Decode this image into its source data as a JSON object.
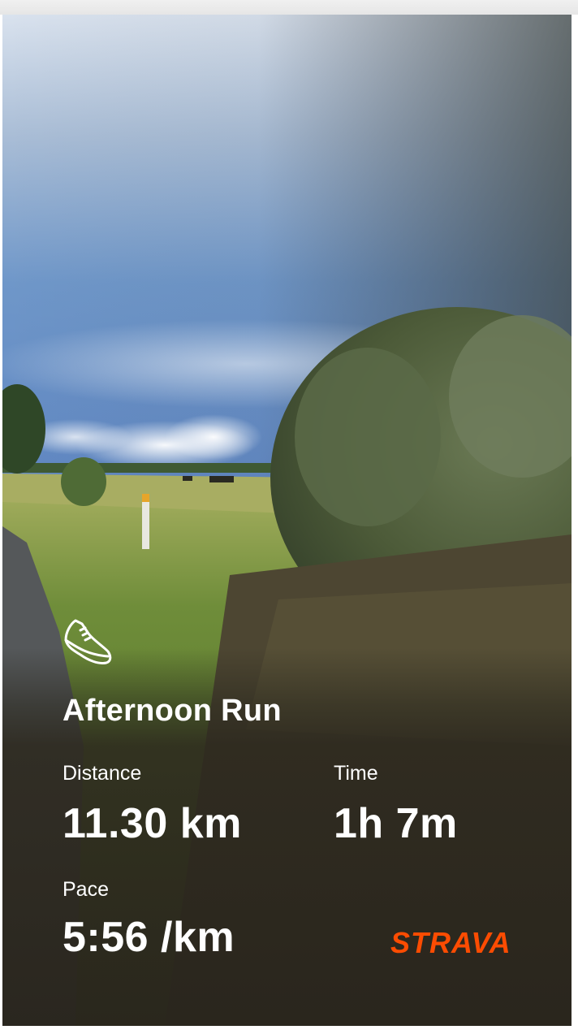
{
  "activity": {
    "icon": "running-shoe-icon",
    "title": "Afternoon Run"
  },
  "stats": {
    "distance_label": "Distance",
    "distance_value": "11.30 km",
    "time_label": "Time",
    "time_value": "1h 7m",
    "pace_label": "Pace",
    "pace_value": "5:56 /km"
  },
  "brand": {
    "name": "STRAVA",
    "color": "#fc4c02"
  }
}
